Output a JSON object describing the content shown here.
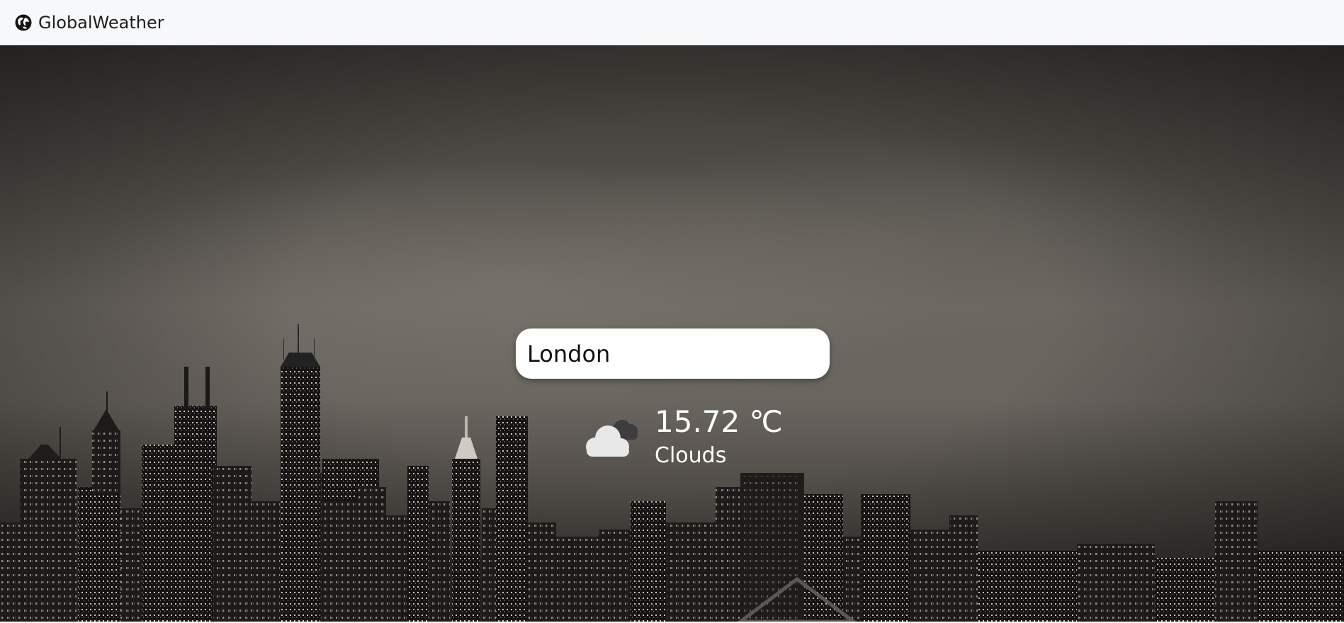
{
  "navbar": {
    "brand": "GlobalWeather",
    "brand_icon": "globe-icon"
  },
  "search": {
    "value": "London"
  },
  "weather": {
    "temperature": "15.72 ℃",
    "condition": "Clouds",
    "icon": "cloud-icon"
  }
}
